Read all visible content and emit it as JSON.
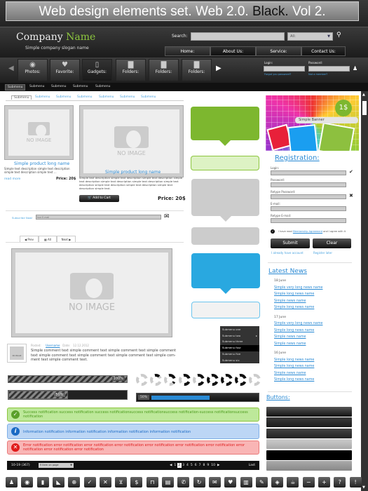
{
  "banner": {
    "title_main": "Web design elements set. Web 2.0.",
    "title_accent": "Black.",
    "title_end": "Vol 2."
  },
  "header": {
    "company_first": "Company",
    "company_second": "Name",
    "slogan": "Simple company slogan name",
    "search_label": "Search:",
    "search_value": "",
    "search_scope": "All:",
    "nav": [
      "Home:",
      "About Us:",
      "Service:",
      "Contact Us:"
    ],
    "active_nav": 1
  },
  "iconbar": {
    "items": [
      {
        "label": "Photos:",
        "icon": "camera-icon"
      },
      {
        "label": "Favorite:",
        "icon": "heart-icon"
      },
      {
        "label": "Gadgets:",
        "icon": "ipod-icon"
      },
      {
        "label": "Folders:",
        "icon": "folder-icon"
      },
      {
        "label": "Folders:",
        "icon": "folder-icon"
      },
      {
        "label": "Folders:",
        "icon": "folder-icon"
      }
    ],
    "login_label": "Login:",
    "password_label": "Password:",
    "forgot": "Forgot you password?",
    "not_member": "Not a member?"
  },
  "submenu_dark": [
    "Submenu",
    "Submenu",
    "Submenu",
    "Submenu",
    "Submenu"
  ],
  "submenu_tabs": [
    "Submenu",
    "Submenu",
    "Submenu",
    "Submenu",
    "Submenu",
    "Submenu",
    "Submenu"
  ],
  "no_image": "NO IMAGE",
  "product1": {
    "name": "Simple product long name",
    "desc": "Simple text description simple text description simple text description simple text ...",
    "read_more": "read more",
    "price": "Price:  20$"
  },
  "product2": {
    "name": "Simple product long name",
    "desc": "Simple text description simple text description simple text description simple text description simple text description simple text description simple text description simple text description simple text description simple text description simple text.",
    "add_to_cart": "Add to Cart",
    "price": "Price:  20$"
  },
  "subscribe": {
    "label": "Subscribe Now!",
    "placeholder": "Your E-mail"
  },
  "pager_small": {
    "prev": "Prev",
    "all": "All",
    "next": "Next"
  },
  "comment": {
    "avatar_text": "NO IMAGE",
    "posted": "Posted:",
    "username": "Username",
    "date_label": "Date:",
    "date": "12.12.2012",
    "text": "Simple comment text simple comment text  simple comment text simple comment text simple comment text simple comment text simple comment text simple com-ment text simple comment text."
  },
  "progress": {
    "bar1": "100%",
    "bar1_value": 100,
    "bar2": "50%",
    "bar2_value": 50,
    "bar3": "50%",
    "bar3_value": 50,
    "bar3_color": "#2a8ad4"
  },
  "dropdown_menu": {
    "items": [
      "Submenu one",
      "Submenu two",
      "Submenu three",
      "Submenu four",
      "Submenu five",
      "Submenu six"
    ],
    "active": 3
  },
  "notifications": {
    "success": "Success notification success notification success notificationsuccess notificationsuccess notification-success notificationsuccess notification",
    "info": "Information notification information notification information notification information notification",
    "error": "Error notification error notification error notification error notification error notification error notification error notification error notification error notification error notification",
    "colors": {
      "success": "#bde89a",
      "info": "#bcd6f5",
      "error": "#f9b5b5"
    }
  },
  "pagination": {
    "range": "10-19 (367)",
    "per_page": "9 item on page",
    "pages": [
      "1",
      "2",
      "3",
      "4",
      "5",
      "6",
      "7",
      "8",
      "9",
      "10"
    ],
    "current": "2",
    "last": "Last"
  },
  "banner_ad": {
    "price": "1$",
    "label": "Simple Banner"
  },
  "registration": {
    "title": "Registration:",
    "fields": [
      "Login:",
      "Password:",
      "Retype Password:",
      "E-mail:",
      "Retype E-mail:"
    ],
    "agree_pre": "I have read",
    "agree_link": "Membership Agreement",
    "agree_post": "and I agree with it",
    "submit": "Submit",
    "clear": "Clear",
    "have_account": "I already have account",
    "register_later": "Register later"
  },
  "news": {
    "title": "Latest News",
    "groups": [
      {
        "date": "18 June",
        "items": [
          "Simple very long news name",
          "Simple long news name",
          "Simple news name",
          "Simple long news name"
        ]
      },
      {
        "date": "17 June",
        "items": [
          "Simple very long news name",
          "Simple long news name",
          "Simple news name",
          "Simple news name"
        ]
      },
      {
        "date": "16 June",
        "items": [
          "Simple long news name",
          "Simple long news name",
          "Simple news name",
          "Simple long news name"
        ]
      }
    ]
  },
  "buttons_title": "Buttons:",
  "icon_buttons": [
    "user-icon",
    "eye-icon",
    "chart-icon",
    "rss-icon",
    "globe-icon",
    "check-icon",
    "close-icon",
    "cart-icon",
    "dollar-icon",
    "lock-icon",
    "calculator-icon",
    "phone-icon",
    "refresh-icon",
    "mail-icon",
    "heart-icon",
    "trash-icon",
    "pin-icon",
    "tag-icon",
    "coffee-icon",
    "minus-icon",
    "plus-icon",
    "help-icon",
    "alert-icon"
  ],
  "colors": {
    "accent": "#2a8ad4",
    "brand_green": "#8dc63f",
    "bubble_green": "#7db72f",
    "bubble_blue": "#29a8e0"
  }
}
